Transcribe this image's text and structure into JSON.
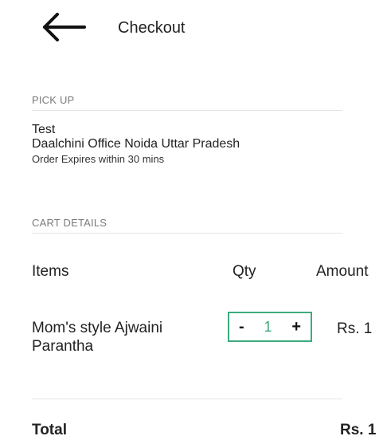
{
  "header": {
    "back_icon": "arrow-left-icon",
    "title": "Checkout"
  },
  "pickup": {
    "section_label": "PICK UP",
    "name": "Test",
    "address": "Daalchini Office Noida Uttar Pradesh",
    "expiry": "Order Expires within 30 mins"
  },
  "cart": {
    "section_label": "CART DETAILS",
    "columns": {
      "items": "Items",
      "qty": "Qty",
      "amount": "Amount"
    },
    "items": [
      {
        "name": "Mom's style Ajwaini Parantha",
        "decrement_label": "-",
        "quantity": "1",
        "increment_label": "+",
        "amount": "Rs. 1"
      }
    ]
  },
  "total": {
    "label": "Total",
    "amount": "Rs. 1"
  },
  "colors": {
    "accent": "#3dab7c",
    "divider": "#e4e4e4",
    "section_label": "#7a7a7a"
  }
}
